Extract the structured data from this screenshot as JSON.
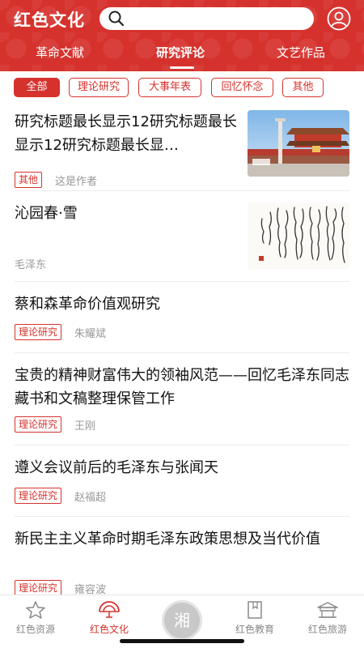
{
  "header": {
    "app_title": "红色文化",
    "search_placeholder": "",
    "search_value": ""
  },
  "tabs": [
    {
      "label": "革命文献",
      "active": false
    },
    {
      "label": "研究评论",
      "active": true
    },
    {
      "label": "文艺作品",
      "active": false
    }
  ],
  "filters": [
    {
      "label": "全部",
      "active": true
    },
    {
      "label": "理论研究",
      "active": false
    },
    {
      "label": "大事年表",
      "active": false
    },
    {
      "label": "回忆怀念",
      "active": false
    },
    {
      "label": "其他",
      "active": false
    }
  ],
  "articles": [
    {
      "title": "研究标题最长显示12研究标题最长显示12研究标题最长显…",
      "tag": "其他",
      "author": "这是作者",
      "thumbnail": "tiananmen-photo"
    },
    {
      "title": "沁园春·雪",
      "tag": "",
      "author": "毛泽东",
      "thumbnail": "calligraphy-image"
    },
    {
      "title": "蔡和森革命价值观研究",
      "tag": "理论研究",
      "author": "朱耀斌"
    },
    {
      "title": "宝贵的精神财富伟大的领袖风范——回忆毛泽东同志藏书和文稿整理保管工作",
      "tag": "理论研究",
      "author": "王刚"
    },
    {
      "title": "遵义会议前后的毛泽东与张闻天",
      "tag": "理论研究",
      "author": "赵福超"
    },
    {
      "title": "新民主主义革命时期毛泽东政策思想及当代价值",
      "tag": "理论研究",
      "author": "雍容波"
    }
  ],
  "bottom_nav": [
    {
      "label": "红色资源",
      "icon": "star-icon",
      "active": false
    },
    {
      "label": "红色文化",
      "icon": "fan-icon",
      "active": true
    },
    {
      "label": "湘",
      "icon": "center-logo",
      "active": false
    },
    {
      "label": "红色教育",
      "icon": "book-icon",
      "active": false
    },
    {
      "label": "红色旅游",
      "icon": "building-icon",
      "active": false
    }
  ],
  "colors": {
    "accent": "#d6322d",
    "muted": "#999999"
  }
}
